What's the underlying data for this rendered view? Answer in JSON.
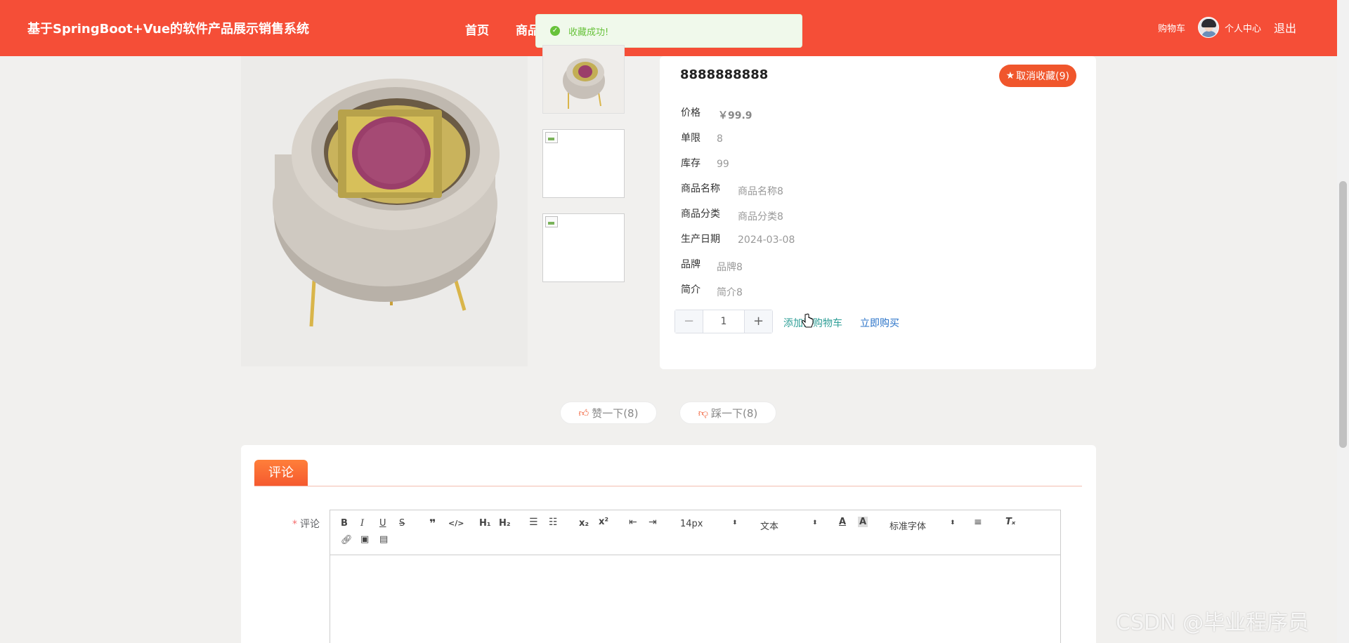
{
  "header": {
    "site_title": "基于SpringBoot+Vue的软件产品展示销售系统",
    "nav": [
      "首页",
      "商品"
    ],
    "cart_label": "购物车",
    "profile_label": "个人中心",
    "logout_label": "退出",
    "bg_color": "#f54e37"
  },
  "toast": {
    "message": "收藏成功!",
    "icon": "success-check-icon",
    "color": "#67c23a"
  },
  "product": {
    "name": "8888888888",
    "favorite_button": "取消收藏(9)",
    "price_label": "价格",
    "price_value": "￥99.9",
    "limit_label": "单限",
    "limit_value": "8",
    "stock_label": "库存",
    "stock_value": "99",
    "name_label": "商品名称",
    "name_value": "商品名称8",
    "category_label": "商品分类",
    "category_value": "商品分类8",
    "date_label": "生产日期",
    "date_value": "2024-03-08",
    "brand_label": "品牌",
    "brand_value": "品牌8",
    "intro_label": "简介",
    "intro_value": "简介8",
    "quantity": "1",
    "add_to_cart": "添加到购物车",
    "buy_now": "立即购买"
  },
  "votes": {
    "like": "赞一下(8)",
    "dislike": "踩一下(8)"
  },
  "comments": {
    "tab_label": "评论",
    "field_required": "*",
    "field_label": "评论",
    "toolbar": {
      "size_select": "14px",
      "text_select": "文本",
      "font_select": "标准字体"
    }
  },
  "watermark": "CSDN @毕业程序员"
}
